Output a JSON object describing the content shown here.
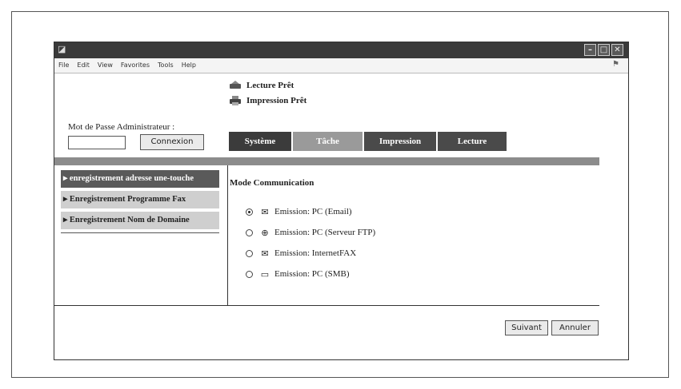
{
  "window": {
    "title": "",
    "menu": [
      "File",
      "Edit",
      "View",
      "Favorites",
      "Tools",
      "Help"
    ]
  },
  "status": {
    "items": [
      {
        "label": "Lecture Prêt",
        "icon": "scanner-icon"
      },
      {
        "label": "Impression Prêt",
        "icon": "printer-icon"
      }
    ]
  },
  "login": {
    "label": "Mot de Passe Administrateur :",
    "password_value": "",
    "button": "Connexion"
  },
  "tabs": [
    "Système",
    "Tâche",
    "Impression",
    "Lecture"
  ],
  "sidebar": {
    "items": [
      {
        "label": "enregistrement adresse une-touche",
        "active": true
      },
      {
        "label": "Enregistrement Programme Fax",
        "active": false
      },
      {
        "label": "Enregistrement Nom de Domaine",
        "active": false
      }
    ]
  },
  "main": {
    "heading": "Mode Communication",
    "options": [
      {
        "label": "Emission: PC (Email)",
        "icon": "envelope-icon",
        "selected": true
      },
      {
        "label": "Emission: PC (Serveur FTP)",
        "icon": "ftp-icon",
        "selected": false
      },
      {
        "label": "Emission: InternetFAX",
        "icon": "envelope-icon",
        "selected": false
      },
      {
        "label": "Emission: PC (SMB)",
        "icon": "computer-icon",
        "selected": false
      }
    ]
  },
  "footer": {
    "next": "Suivant",
    "cancel": "Annuler"
  }
}
